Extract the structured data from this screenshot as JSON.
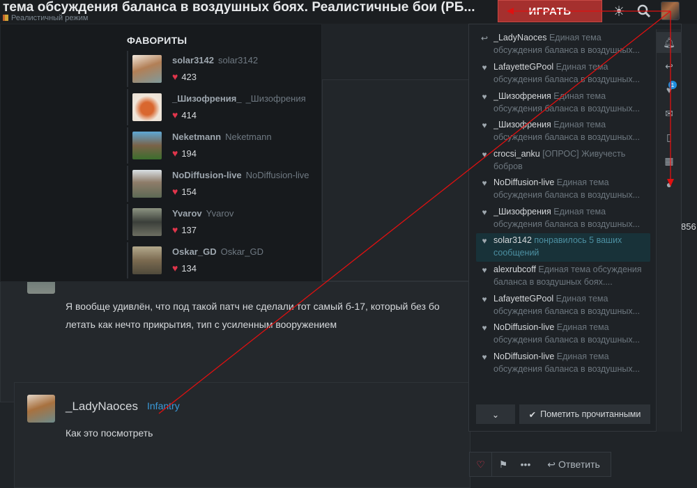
{
  "header": {
    "title": "тема обсуждения баланса в воздушных боях. Реалистичные бои (РБ...",
    "subtitle": "Реалистичный режим",
    "play_label": "ИГРАТЬ"
  },
  "favorites": {
    "heading": "ФАВОРИТЫ",
    "items": [
      {
        "name": "solar3142",
        "alt": "solar3142",
        "likes": "423"
      },
      {
        "name": "_Шизофрения_",
        "alt": "_Шизофрения",
        "likes": "414"
      },
      {
        "name": "Neketmann",
        "alt": "Neketmann",
        "likes": "194"
      },
      {
        "name": "NoDiffusion-live",
        "alt": "NoDiffusion-live",
        "likes": "154"
      },
      {
        "name": "Yvarov",
        "alt": "Yvarov",
        "likes": "137"
      },
      {
        "name": "Oskar_GD",
        "alt": "Oskar_GD",
        "likes": "134"
      }
    ]
  },
  "posts": [
    {
      "text_line1": "Я вообще удивлён, что под такой патч не сделали тот самый б-17, который без бо",
      "text_line2": "летать как нечто прикрытия, тип с усиленным вооружением"
    },
    {
      "author": "_LadyNaoces",
      "role": "Infantry",
      "text": "Как это посмотреть"
    }
  ],
  "post_actions": {
    "reply_label": "Ответить"
  },
  "side_number": "856",
  "notifications": {
    "items": [
      {
        "icon": "reply-icon",
        "user": "_LadyNaoces",
        "text": "Единая тема обсуждения баланса в воздушных..."
      },
      {
        "icon": "heart-icon",
        "user": "LafayetteGPool",
        "text": "Единая тема обсуждения баланса в воздушных..."
      },
      {
        "icon": "heart-icon",
        "user": "_Шизофрения",
        "text": "Единая тема обсуждения баланса в воздушных..."
      },
      {
        "icon": "heart-icon",
        "user": "_Шизофрения",
        "text": "Единая тема обсуждения баланса в воздушных..."
      },
      {
        "icon": "heart-icon",
        "user": "crocsi_anku",
        "text": "[ОПРОС] Живучесть бобров"
      },
      {
        "icon": "heart-icon",
        "user": "NoDiffusion-live",
        "text": "Единая тема обсуждения баланса в воздушных..."
      },
      {
        "icon": "heart-icon",
        "user": "_Шизофрения",
        "text": "Единая тема обсуждения баланса в воздушных..."
      },
      {
        "icon": "heart-icon",
        "user": "solar3142",
        "text": "понравилось 5 ваших сообщений"
      },
      {
        "icon": "heart-icon",
        "user": "alexrubcoff",
        "text": "Единая тема обсуждения баланса в воздушных боях...."
      },
      {
        "icon": "heart-icon",
        "user": "LafayetteGPool",
        "text": "Единая тема обсуждения баланса в воздушных..."
      },
      {
        "icon": "heart-icon",
        "user": "NoDiffusion-live",
        "text": "Единая тема обсуждения баланса в воздушных..."
      },
      {
        "icon": "heart-icon",
        "user": "NoDiffusion-live",
        "text": "Единая тема обсуждения баланса в воздушных..."
      }
    ],
    "mark_read_label": "Пометить прочитанными",
    "badge_count": "1"
  },
  "colors": {
    "accent": "#a5302e",
    "link": "#3a9ad9",
    "heart": "#e0354b",
    "highlight": "#183239"
  }
}
